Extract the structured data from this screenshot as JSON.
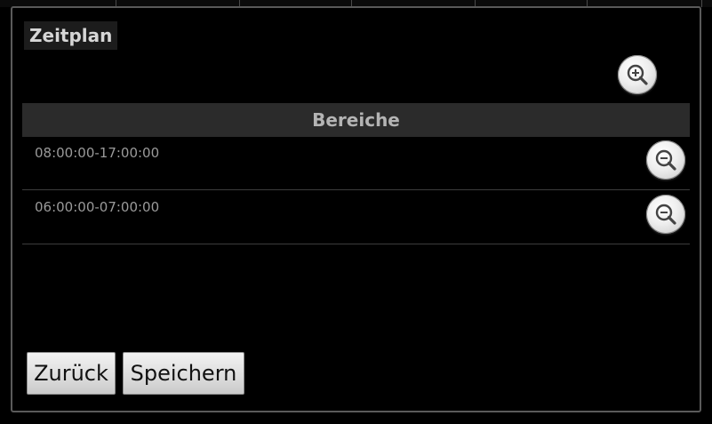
{
  "dialog": {
    "title": "Zeitplan",
    "add_icon": "zoom-in-icon"
  },
  "ranges": {
    "header": "Bereiche",
    "remove_icon": "zoom-out-icon",
    "items": [
      {
        "label": "08:00:00-17:00:00"
      },
      {
        "label": "06:00:00-07:00:00"
      }
    ]
  },
  "buttons": {
    "back_label": "Zurück",
    "save_label": "Speichern"
  },
  "colors": {
    "background": "#000000",
    "header_bg": "#2b2b2b",
    "header_text": "#b4b4b4",
    "row_text": "#9a9a9a",
    "divider": "#3d3d3d"
  }
}
